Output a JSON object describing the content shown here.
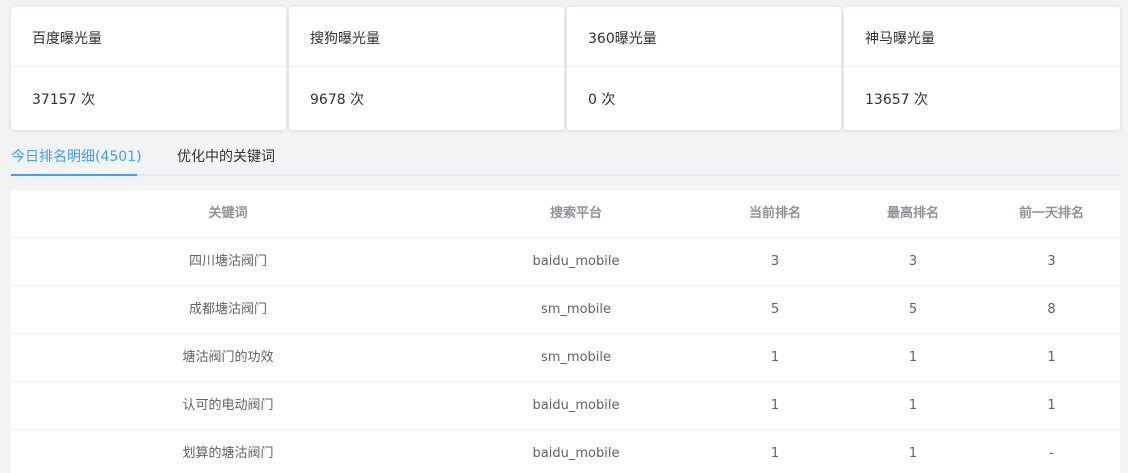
{
  "stats": [
    {
      "label": "百度曝光量",
      "value": "37157 次"
    },
    {
      "label": "搜狗曝光量",
      "value": "9678 次"
    },
    {
      "label": "360曝光量",
      "value": "0 次"
    },
    {
      "label": "神马曝光量",
      "value": "13657 次"
    }
  ],
  "tabs": [
    {
      "label": "今日排名明细(4501)",
      "active": true
    },
    {
      "label": "优化中的关键词",
      "active": false
    }
  ],
  "table": {
    "columns": [
      "关键词",
      "搜索平台",
      "当前排名",
      "最高排名",
      "前一天排名"
    ],
    "rows": [
      [
        "四川塘沽阀门",
        "baidu_mobile",
        "3",
        "3",
        "3"
      ],
      [
        "成都塘沽阀门",
        "sm_mobile",
        "5",
        "5",
        "8"
      ],
      [
        "塘沽阀门的功效",
        "sm_mobile",
        "1",
        "1",
        "1"
      ],
      [
        "认可的电动阀门",
        "baidu_mobile",
        "1",
        "1",
        "1"
      ],
      [
        "划算的塘沽阀门",
        "baidu_mobile",
        "1",
        "1",
        "-"
      ]
    ]
  },
  "colors": {
    "accent": "#409eff",
    "text": "#303133",
    "muted": "#909399",
    "cell": "#606266",
    "background": "#f2f3f5"
  }
}
